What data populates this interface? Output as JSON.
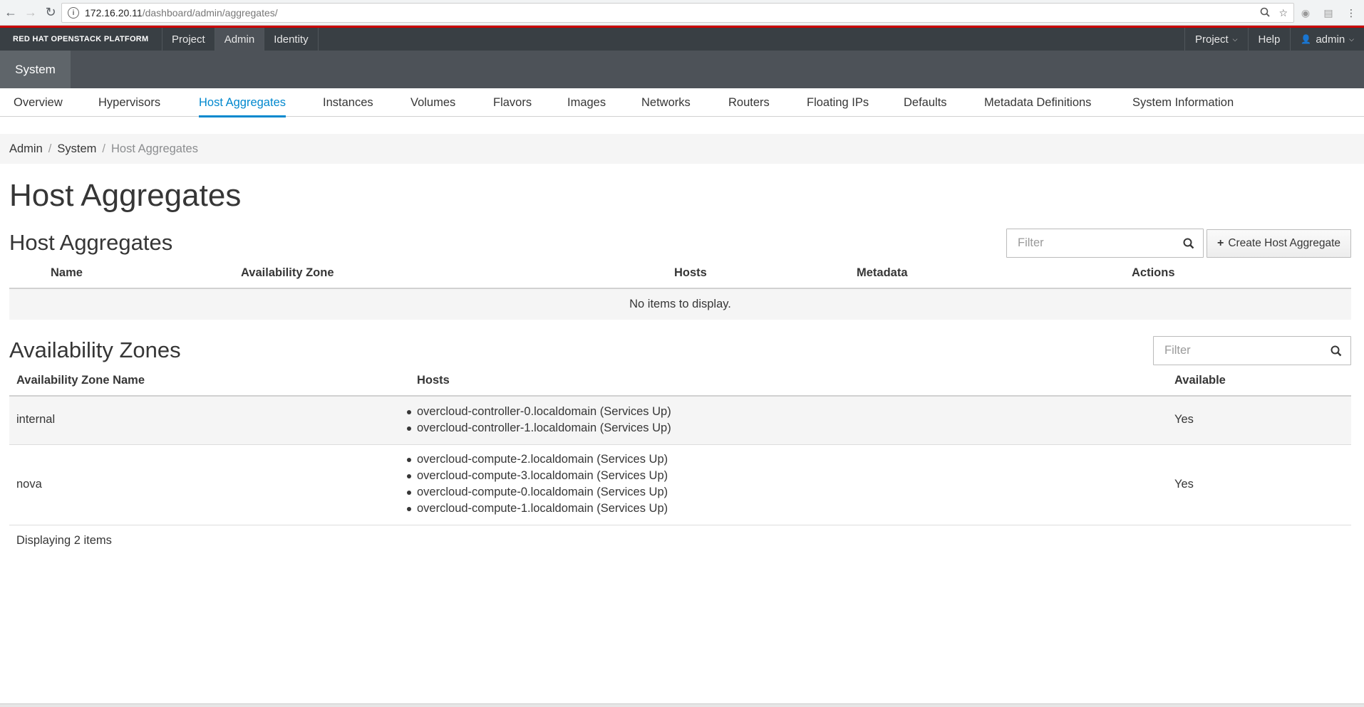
{
  "browser": {
    "url_host": "172.16.20.11",
    "url_path": "/dashboard/admin/aggregates/"
  },
  "topnav": {
    "brand": "RED HAT OPENSTACK PLATFORM",
    "items": [
      "Project",
      "Admin",
      "Identity"
    ],
    "active": "Admin",
    "right": {
      "project_menu": "Project",
      "help": "Help",
      "user": "admin"
    }
  },
  "subnav": {
    "section": "System"
  },
  "tabs": [
    {
      "label": "Overview"
    },
    {
      "label": "Hypervisors"
    },
    {
      "label": "Host Aggregates",
      "active": true
    },
    {
      "label": "Instances"
    },
    {
      "label": "Volumes"
    },
    {
      "label": "Flavors"
    },
    {
      "label": "Images"
    },
    {
      "label": "Networks"
    },
    {
      "label": "Routers"
    },
    {
      "label": "Floating IPs"
    },
    {
      "label": "Defaults"
    },
    {
      "label": "Metadata Definitions"
    },
    {
      "label": "System Information"
    }
  ],
  "breadcrumb": {
    "items": [
      "Admin",
      "System"
    ],
    "current": "Host Aggregates"
  },
  "page_title": "Host Aggregates",
  "aggregates": {
    "title": "Host Aggregates",
    "filter_placeholder": "Filter",
    "create_label": "Create Host Aggregate",
    "columns": {
      "name": "Name",
      "zone": "Availability Zone",
      "hosts": "Hosts",
      "metadata": "Metadata",
      "actions": "Actions"
    },
    "empty_text": "No items to display."
  },
  "zones": {
    "title": "Availability Zones",
    "filter_placeholder": "Filter",
    "columns": {
      "name": "Availability Zone Name",
      "hosts": "Hosts",
      "available": "Available"
    },
    "rows": [
      {
        "name": "internal",
        "hosts": [
          "overcloud-controller-0.localdomain (Services Up)",
          "overcloud-controller-1.localdomain (Services Up)"
        ],
        "available": "Yes"
      },
      {
        "name": "nova",
        "hosts": [
          "overcloud-compute-2.localdomain (Services Up)",
          "overcloud-compute-3.localdomain (Services Up)",
          "overcloud-compute-0.localdomain (Services Up)",
          "overcloud-compute-1.localdomain (Services Up)"
        ],
        "available": "Yes"
      }
    ],
    "footer": "Displaying 2 items"
  },
  "colors": {
    "accent": "#0088ce",
    "brand_red": "#cc0000",
    "topbar": "#393f44"
  }
}
